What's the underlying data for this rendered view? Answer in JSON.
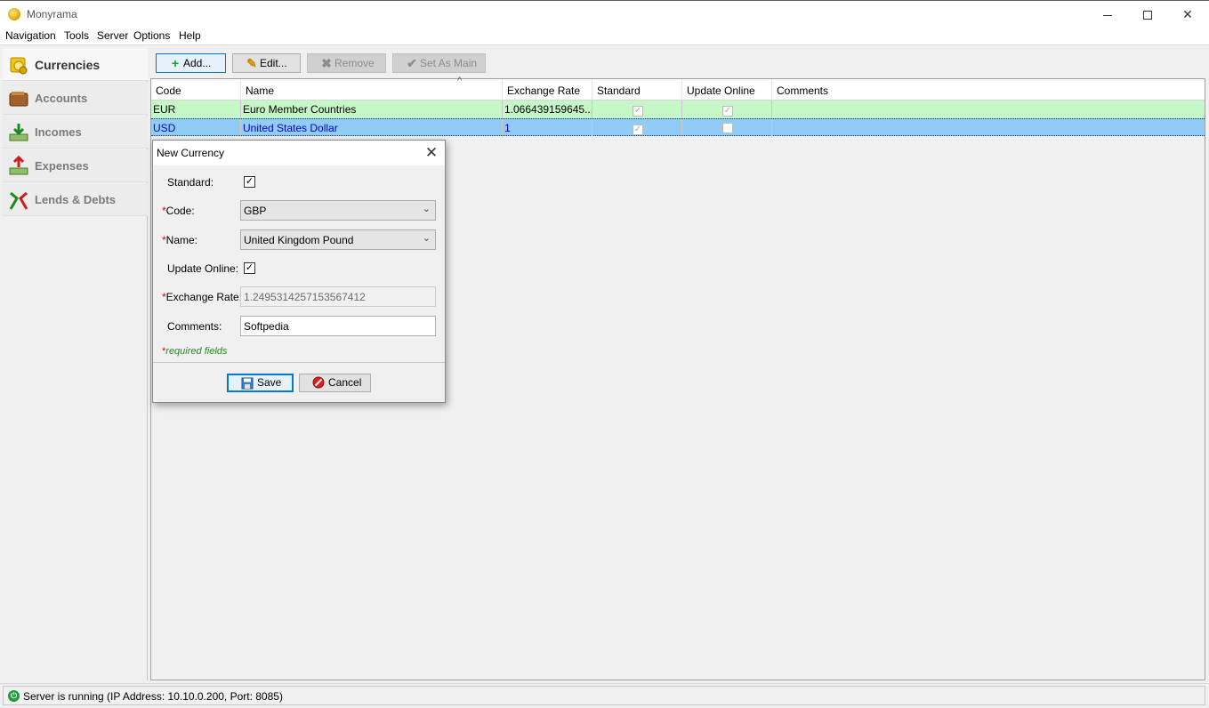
{
  "window": {
    "title": "Monyrama",
    "minimize": "—",
    "close": "✕"
  },
  "menu": [
    "Navigation",
    "Tools",
    "Server",
    "Options",
    "Help"
  ],
  "sidebar": {
    "items": [
      {
        "label": "Currencies",
        "icon": "currencies-icon",
        "active": true
      },
      {
        "label": "Accounts",
        "icon": "wallet-icon"
      },
      {
        "label": "Incomes",
        "icon": "incomes-icon"
      },
      {
        "label": "Expenses",
        "icon": "expenses-icon"
      },
      {
        "label": "Lends & Debts",
        "icon": "lends-debts-icon"
      }
    ]
  },
  "toolbar": {
    "add": "Add...",
    "edit": "Edit...",
    "remove": "Remove",
    "set_main": "Set As Main"
  },
  "table": {
    "columns": [
      "Code",
      "Name",
      "Exchange Rate",
      "Standard",
      "Update Online",
      "Comments"
    ],
    "sort_indicator": "^",
    "rows": [
      {
        "code": "EUR",
        "name": "Euro Member Countries",
        "rate": "1.066439159645...",
        "standard": true,
        "update_online": true,
        "comments": ""
      },
      {
        "code": "USD",
        "name": "United States Dollar",
        "rate": "1",
        "standard": true,
        "update_online": false,
        "comments": ""
      }
    ]
  },
  "dialog": {
    "title": "New Currency",
    "close": "✕",
    "required_mark": "*",
    "standard_label": "Standard:",
    "standard_checked": true,
    "code_label": "Code:",
    "code_value": "GBP",
    "name_label": "Name:",
    "name_value": "United Kingdom Pound",
    "update_online_label": "Update Online:",
    "update_online_checked": true,
    "exchange_rate_label": "Exchange Rate:",
    "exchange_rate_value": "1.2495314257153567412",
    "comments_label": "Comments:",
    "comments_value": "Softpedia",
    "required_note": "required fields",
    "save": "Save",
    "cancel": "Cancel"
  },
  "status": {
    "text": "Server is running (IP Address: 10.10.0.200, Port: 8085)"
  },
  "colors": {
    "eur_row": "#c6f7c6",
    "usd_row": "#90ccf5",
    "accent": "#0078d7",
    "required": "#e00000",
    "status_ok": "#1a9e3a"
  }
}
